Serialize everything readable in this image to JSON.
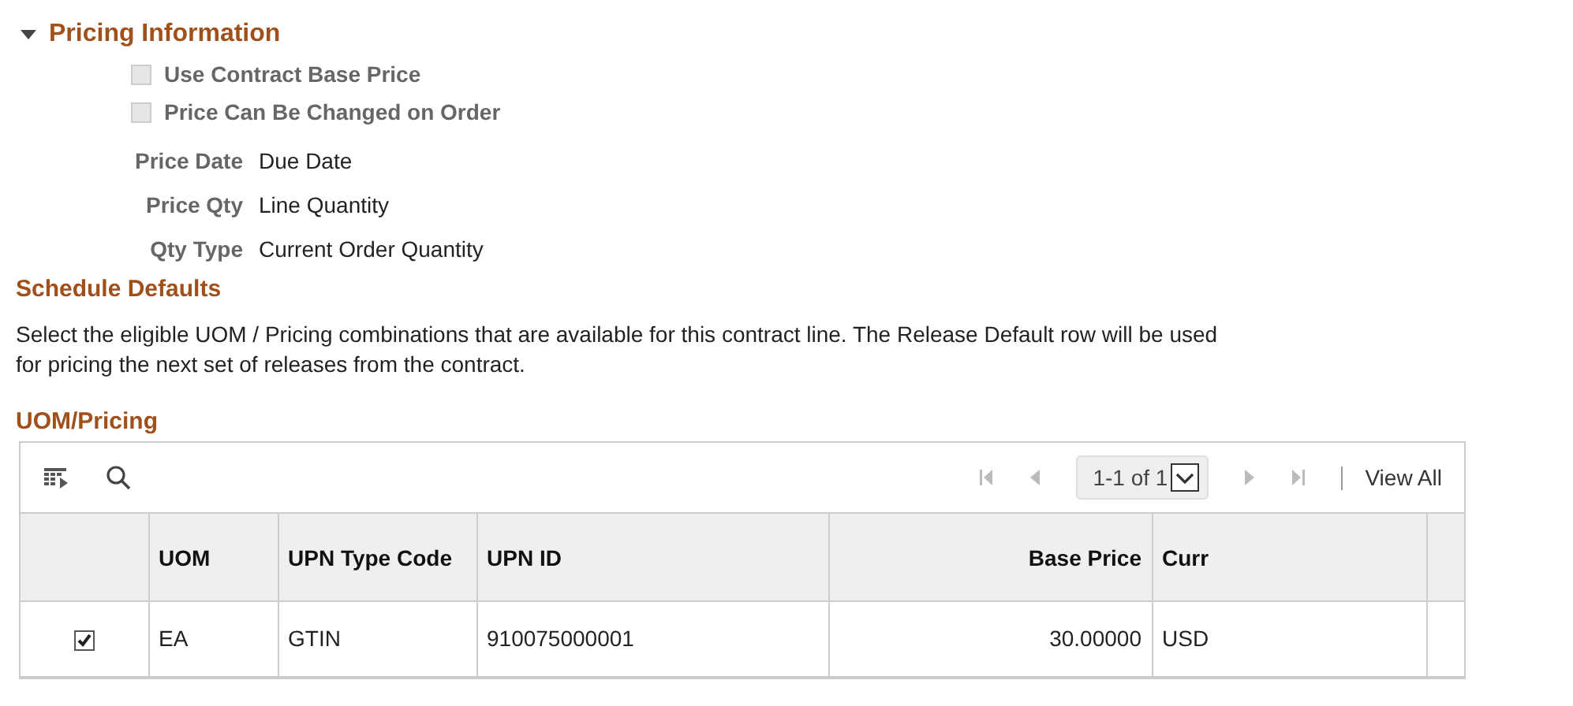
{
  "pricing_section": {
    "title": "Pricing Information",
    "expanded": true,
    "checkboxes": [
      {
        "label": "Use Contract Base Price",
        "checked": false,
        "disabled": true
      },
      {
        "label": "Price Can Be Changed on Order",
        "checked": false,
        "disabled": true
      }
    ],
    "fields": [
      {
        "label": "Price Date",
        "value": "Due Date"
      },
      {
        "label": "Price Qty",
        "value": "Line Quantity"
      },
      {
        "label": "Qty Type",
        "value": "Current Order Quantity"
      }
    ]
  },
  "schedule_defaults": {
    "title": "Schedule Defaults",
    "description": "Select the eligible UOM / Pricing combinations that are available for this contract line. The Release Default row will be used for pricing the next set of releases from the contract."
  },
  "grid": {
    "title": "UOM/Pricing",
    "pagination": {
      "range": "1-1 of 1",
      "view_all": "View All"
    },
    "columns": [
      "UOM",
      "UPN Type Code",
      "UPN ID",
      "Base Price",
      "Curr"
    ],
    "rows": [
      {
        "selected": true,
        "cells": [
          "EA",
          "GTIN",
          "910075000001",
          "30.00000",
          "USD"
        ]
      }
    ]
  }
}
